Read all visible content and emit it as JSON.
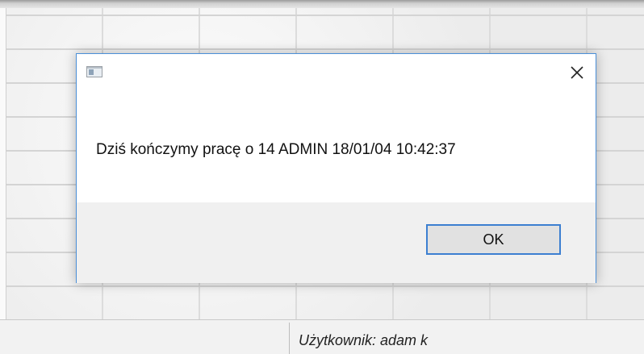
{
  "dialog": {
    "message": "Dziś kończymy pracę o 14 ADMIN 18/01/04 10:42:37",
    "ok_label": "OK",
    "close_glyph": "close-icon",
    "title_icon": "app-window-icon",
    "accent_color": "#3c7fd1"
  },
  "status_bar": {
    "user_text": "Użytkownik: adam k"
  }
}
